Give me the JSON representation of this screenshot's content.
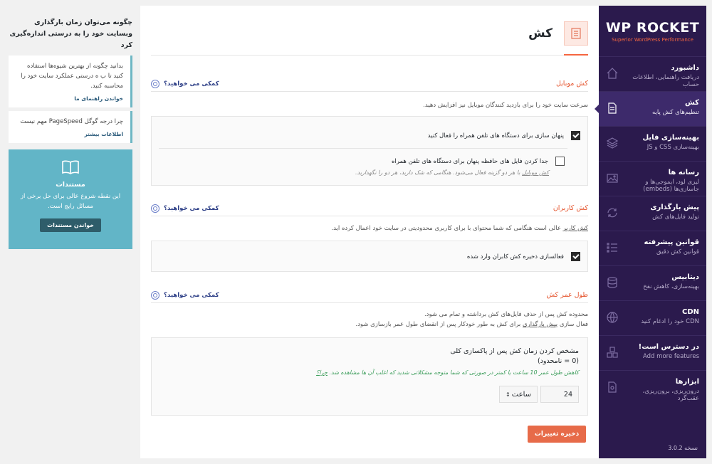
{
  "sidebar": {
    "logo_main_a": "WP ",
    "logo_main_b": "ROCKET",
    "logo_sub": "Superior WordPress Performance",
    "items": [
      {
        "title": "داشبورد",
        "sub": "دریافت راهنمایی، اطلاعات حساب",
        "icon": "home-icon"
      },
      {
        "title": "کش",
        "sub": "تنظیم‌های کش پایه",
        "icon": "document-icon"
      },
      {
        "title": "بهینه‌سازی فایل",
        "sub": "بهینه‌سازی CSS و JS",
        "icon": "layers-icon"
      },
      {
        "title": "رسانه ها",
        "sub": "لیزی لود، ایموجی‌ها و جاسازی‌ها (embeds)",
        "icon": "image-icon"
      },
      {
        "title": "پیش بارگذاری",
        "sub": "تولید فایل‌های کش",
        "icon": "refresh-icon"
      },
      {
        "title": "قوانین پیشرفته",
        "sub": "قوانین کش دقیق",
        "icon": "list-icon"
      },
      {
        "title": "دیتابیس",
        "sub": "بهینه‌سازی، کاهش نفخ",
        "icon": "database-icon"
      },
      {
        "title": "CDN",
        "sub": "CDN خود را ادغام کنید",
        "icon": "globe-icon"
      },
      {
        "title": "در دسترس است!",
        "sub": "Add more features",
        "icon": "addons-icon"
      },
      {
        "title": "ابزارها",
        "sub": "درون‌ریزی، برون‌ریزی، عقب‌گرد",
        "icon": "tools-icon"
      }
    ],
    "version": "نسخه 3.0.2"
  },
  "main": {
    "page_title": "کش",
    "help_label": "کمکی می خواهید؟",
    "mobile": {
      "title": "کش موبایل",
      "desc": "سرعت سایت خود را برای بازدید کنندگان موبایل نیز افزایش دهید.",
      "opt1": "پنهان سازی برای دستگاه های تلفن همراه را فعال کنید",
      "opt2": "جدا کردن فایل های حافظه پنهان برای دستگاه های تلفن همراه",
      "note_link": "کش موبایل",
      "note_rest": " با هر دو گزینه فعال می‌شود. هنگامی که شک دارید، هر دو را نگهدارید."
    },
    "user": {
      "title": "کش کاربران",
      "desc_link": "کش کاربر",
      "desc_rest": " عالی است هنگامی که شما محتوای با برای کاربری محدودیتی در سایت خود اعمال کرده اید.",
      "opt1": "فعالسازی ذخیره کش کابران وارد شده"
    },
    "lifespan": {
      "title": "طول عمر کش",
      "desc1": "محدوده کش پس از حذف فایل‌های کش برداشته و تمام می شود.",
      "desc2_a": "فعال سازی ",
      "desc2_link": "پیش بارگذاری",
      "desc2_b": " برای کش به طور خودکار پس از انقضای طول عمر بازسازی شود.",
      "label1": "مشخص کردن زمان کش پس از پاکسازی کلی",
      "label2": "(0 = نامحدود)",
      "hint_a": "کاهش طول عمر 10 ساعت یا کمتر در صورتی که شما متوجه مشکلاتی شدید که اغلب آن ها مشاهده شد. ",
      "hint_link": "چرا؟",
      "value": "24",
      "unit": "ساعت"
    },
    "save_label": "ذخیره تغییرات"
  },
  "left": {
    "promo_title": "چگونه می‌توان زمان بارگذاری وبسایت خود را به درستی اندازه‌گیری کرد",
    "card1_text": "بدانید چگونه از بهترین شیوه‌ها استفاده کنید تا ب ه درستی عملکرد سایت خود را محاسبه کنید.",
    "card1_link": "خواندن راهنمای ما",
    "card2_text": "چرا درجه گوگل PageSpeed مهم نیست",
    "card2_link": "اطلاعات بیشتر",
    "docs_title": "مستندات",
    "docs_text": "این نقطه شروع عالی برای حل برخی از مسائل رایج است.",
    "docs_button": "خواندن مستندات"
  }
}
